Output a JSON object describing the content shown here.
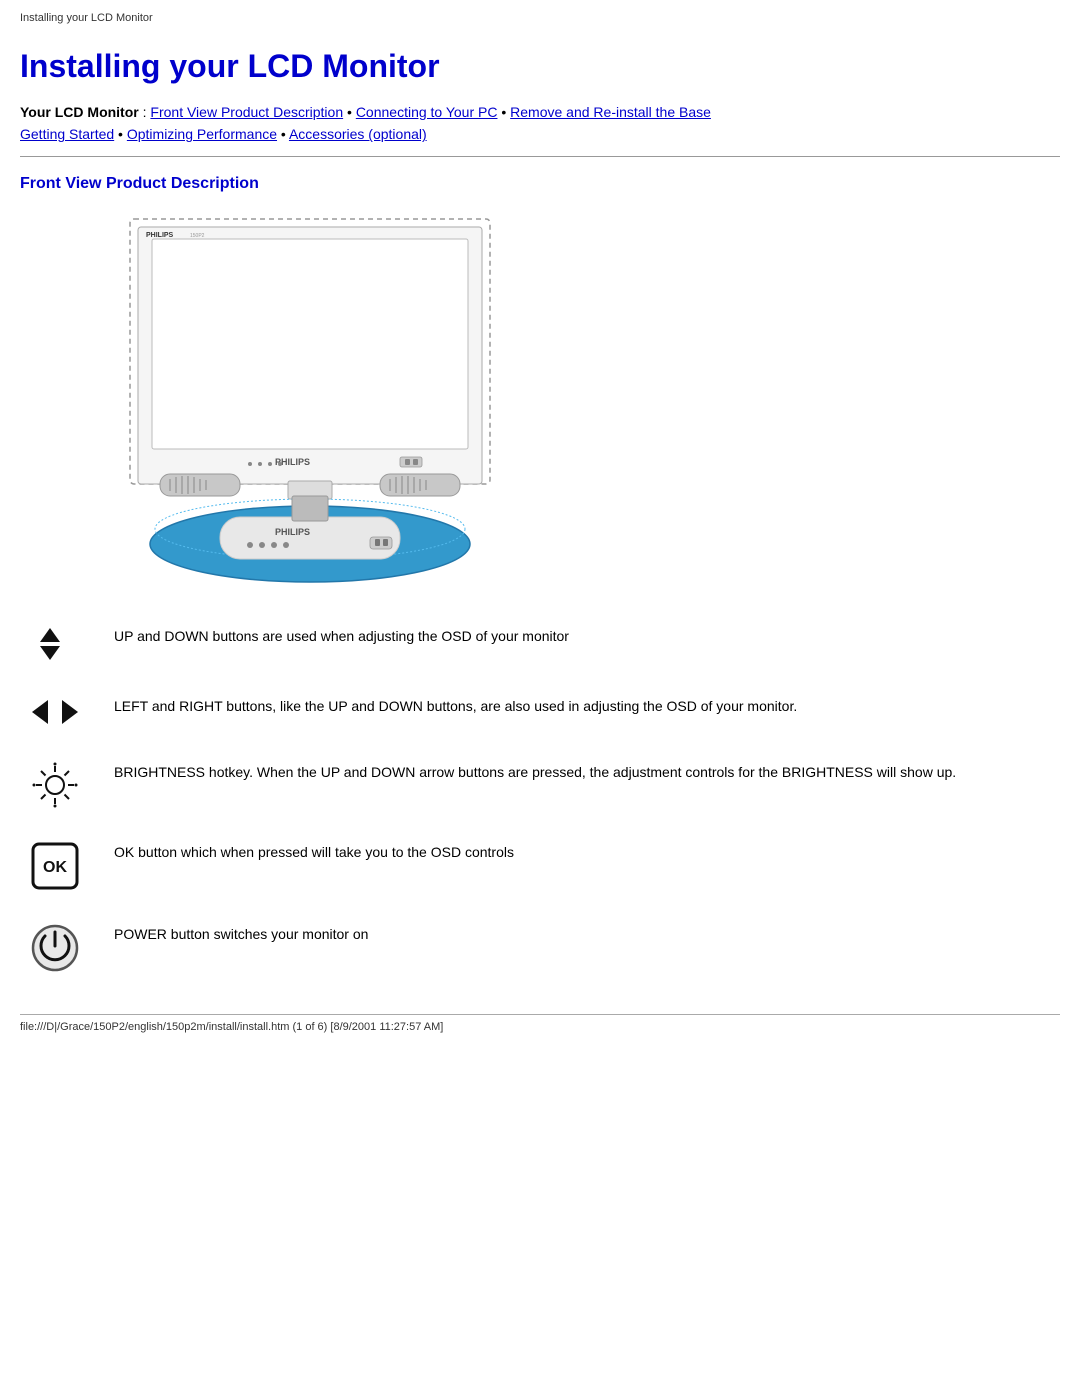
{
  "browser_tab": "Installing your LCD Monitor",
  "page_title": "Installing your LCD Monitor",
  "nav": {
    "prefix": "Your LCD Monitor",
    "separator": " : ",
    "links": [
      {
        "label": "Front View Product Description",
        "href": "#front"
      },
      {
        "label": "Connecting to Your PC",
        "href": "#connecting"
      },
      {
        "label": "Remove and Re-install the Base",
        "href": "#remove"
      },
      {
        "label": "Getting Started",
        "href": "#getting"
      },
      {
        "label": "Optimizing Performance",
        "href": "#optimizing"
      },
      {
        "label": "Accessories (optional)",
        "href": "#accessories"
      }
    ]
  },
  "section1_title": "Front View Product Description",
  "features": [
    {
      "icon_name": "up-down-arrows-icon",
      "text": "UP and DOWN buttons are used when adjusting the OSD of your monitor"
    },
    {
      "icon_name": "left-right-arrows-icon",
      "text": "LEFT and RIGHT buttons, like the UP and DOWN buttons, are also used in adjusting the OSD of your monitor."
    },
    {
      "icon_name": "brightness-icon",
      "text": "BRIGHTNESS hotkey. When the UP and DOWN arrow buttons are pressed, the adjustment controls for the BRIGHTNESS will show up."
    },
    {
      "icon_name": "ok-button-icon",
      "text": "OK button which when pressed will take you to the OSD controls"
    },
    {
      "icon_name": "power-button-icon",
      "text": "POWER button switches your monitor on"
    }
  ],
  "status_bar": "file:///D|/Grace/150P2/english/150p2m/install/install.htm (1 of 6) [8/9/2001 11:27:57 AM]"
}
